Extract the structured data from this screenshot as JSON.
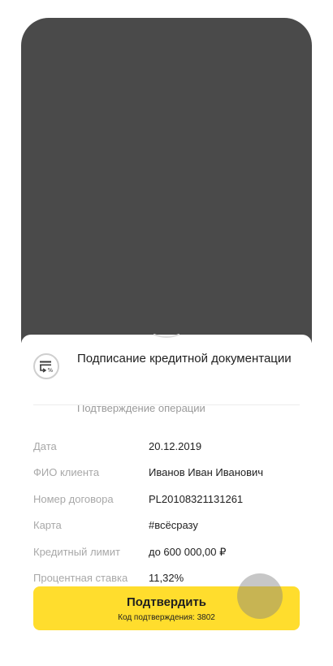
{
  "operation": {
    "icon": "document-credit-icon",
    "title": "Подписание кредитной документации",
    "subtitle": "Подтверждение операции"
  },
  "details": [
    {
      "label": "Дата",
      "value": "20.12.2019"
    },
    {
      "label": "ФИО клиента",
      "value": "Иванов Иван Иванович"
    },
    {
      "label": "Номер договора",
      "value": "PL20108321131261"
    },
    {
      "label": "Карта",
      "value": "#всёсразу"
    },
    {
      "label": "Кредитный лимит",
      "value": "до 600 000,00 ₽"
    },
    {
      "label": "Процентная ставка",
      "value": "11,32%"
    }
  ],
  "confirm": {
    "label": "Подтвердить",
    "code_text": "Код подтверждения: 3802"
  },
  "colors": {
    "accent": "#ffdd2d",
    "overlay": "#4a4a4a"
  }
}
